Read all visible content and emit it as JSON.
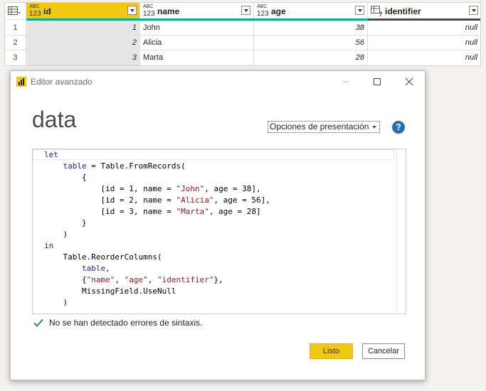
{
  "grid": {
    "columns": [
      {
        "type_small": "ABC",
        "type_big": "123",
        "name": "id"
      },
      {
        "type_small": "ABC",
        "type_big": "123",
        "name": "name"
      },
      {
        "type_small": "ABC",
        "type_big": "123",
        "name": "age"
      },
      {
        "name": "identifier"
      }
    ],
    "rows": [
      {
        "n": "1",
        "id": "1",
        "name": "John",
        "age": "38",
        "identifier": "null"
      },
      {
        "n": "2",
        "id": "2",
        "name": "Alicia",
        "age": "56",
        "identifier": "null"
      },
      {
        "n": "3",
        "id": "3",
        "name": "Marta",
        "age": "28",
        "identifier": "null"
      }
    ]
  },
  "dialog": {
    "title": "Editor avanzado",
    "query_name": "data",
    "options_label": "Opciones de presentación",
    "help_glyph": "?",
    "code": {
      "l1": "let",
      "l2a": "table",
      "l2b": " = Table.FromRecords(",
      "l3": "{",
      "l4a": "[id = 1, name = ",
      "l4s": "\"John\"",
      "l4b": ", age = 38],",
      "l5a": "[id = 2, name = ",
      "l5s": "\"Alicia\"",
      "l5b": ", age = 56],",
      "l6a": "[id = 3, name = ",
      "l6s": "\"Marta\"",
      "l6b": ", age = 28]",
      "l7": "}",
      "l8": ")",
      "l9": "in",
      "l10": "Table.ReorderColumns(",
      "l11": "table,",
      "l12a": "{",
      "l12s1": "\"name\"",
      "l12c1": ", ",
      "l12s2": "\"age\"",
      "l12c2": ", ",
      "l12s3": "\"identifier\"",
      "l12b": "},",
      "l13": "MissingField.UseNull",
      "l14": ")"
    },
    "status_text": "No se han detectado errores de sintaxis.",
    "ok_label": "Listo",
    "cancel_label": "Cancelar"
  },
  "colors": {
    "accent": "#f2c811",
    "teal": "#00b294",
    "keyword": "#1b1bb5",
    "string": "#a31515",
    "status_ok": "#2e8b57"
  },
  "icons": {
    "table": "table-icon",
    "app": "power-bi-icon",
    "help": "help-icon",
    "check": "checkmark-icon"
  }
}
